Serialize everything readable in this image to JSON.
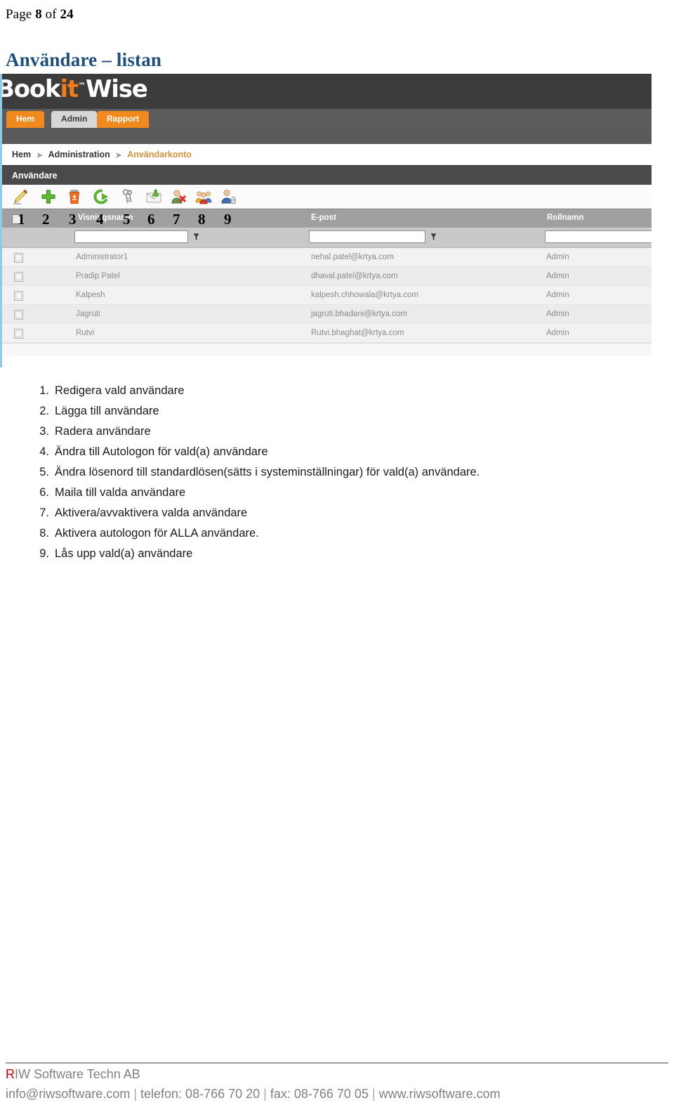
{
  "page": {
    "label_prefix": "Page ",
    "current": "8",
    "label_mid": " of ",
    "total": "24",
    "title": "Användare – listan"
  },
  "app": {
    "logo": {
      "text_before": "Book",
      "text_accent": "it",
      "text_after": "Wise",
      "tm": "™"
    },
    "tabs": [
      {
        "label": "Hem",
        "state": "normal"
      },
      {
        "label": "Admin",
        "state": "active"
      },
      {
        "label": "Rapport",
        "state": "normal"
      }
    ],
    "breadcrumb": {
      "items": [
        "Hem",
        "Administration",
        "Användarkonto"
      ],
      "separator": "➤"
    },
    "panel_title": "Användare",
    "toolbar": {
      "buttons": [
        {
          "icon": "pencil-edit-icon",
          "callout": "1",
          "tooltip": "Redigera vald användare"
        },
        {
          "icon": "green-plus-add-icon",
          "callout": "2",
          "tooltip": "Lägga till användare"
        },
        {
          "icon": "orange-trash-delete-icon",
          "callout": "3",
          "tooltip": "Radera användare"
        },
        {
          "icon": "green-refresh-autologon-icon",
          "callout": "4",
          "tooltip": "Ändra till Autologon"
        },
        {
          "icon": "keys-password-icon",
          "callout": "5",
          "tooltip": "Ändra lösenord"
        },
        {
          "icon": "envelope-mail-icon",
          "callout": "6",
          "tooltip": "Maila till valda användare"
        },
        {
          "icon": "user-deactivate-icon",
          "callout": "7",
          "tooltip": "Aktivera/avvaktivera"
        },
        {
          "icon": "user-group-all-icon",
          "callout": "8",
          "tooltip": "Aktivera autologon för ALLA"
        },
        {
          "icon": "user-unlock-icon",
          "callout": "9",
          "tooltip": "Lås upp vald(a) användare"
        }
      ]
    },
    "table": {
      "columns": [
        "Visningsnamn",
        "E-post",
        "Rollnamn"
      ],
      "filters": [
        "",
        "",
        ""
      ],
      "filter_icon": "funnel-filter-icon",
      "rows": [
        {
          "checked": false,
          "name": "Administrator1",
          "email": "nehal.patel@krtya.com",
          "role": "Admin"
        },
        {
          "checked": false,
          "name": "Pradip Patel",
          "email": "dhaval.patel@krtya.com",
          "role": "Admin"
        },
        {
          "checked": false,
          "name": "Kalpesh",
          "email": "kalpesh.chhowala@krtya.com",
          "role": "Admin"
        },
        {
          "checked": false,
          "name": "Jagruti",
          "email": "jagruti.bhadani@krtya.com",
          "role": "Admin"
        },
        {
          "checked": false,
          "name": "Rutvi",
          "email": "Rutvi.bhaghat@krtya.com",
          "role": "Admin"
        }
      ]
    },
    "colors": {
      "accent_orange": "#f08a1e",
      "dark_header": "#3c3c3c",
      "breadcrumb_current": "#d5923e",
      "title_blue": "#1f4e79"
    }
  },
  "legend": {
    "items": [
      {
        "num": "1.",
        "text": "Redigera vald användare"
      },
      {
        "num": "2.",
        "text": "Lägga till användare"
      },
      {
        "num": "3.",
        "text": "Radera användare"
      },
      {
        "num": "4.",
        "text": "Ändra till Autologon för vald(a) användare"
      },
      {
        "num": "5.",
        "text": "Ändra lösenord till standardlösen(sätts i systeminställningar) för vald(a) användare."
      },
      {
        "num": "6.",
        "text": "Maila till valda användare"
      },
      {
        "num": "7.",
        "text": "Aktivera/avvaktivera valda användare"
      },
      {
        "num": "8.",
        "text": "Aktivera autologon för ALLA användare."
      },
      {
        "num": "9.",
        "text": "Lås upp vald(a) användare"
      }
    ]
  },
  "footer": {
    "company_initial": "R",
    "company_rest": "IW Software Techn AB",
    "email": "info@riwsoftware.com",
    "phone_label": "telefon: 08-766 70 20",
    "fax_label": "fax: 08-766 70 05",
    "website": "www.riwsoftware.com",
    "divider": " | "
  }
}
